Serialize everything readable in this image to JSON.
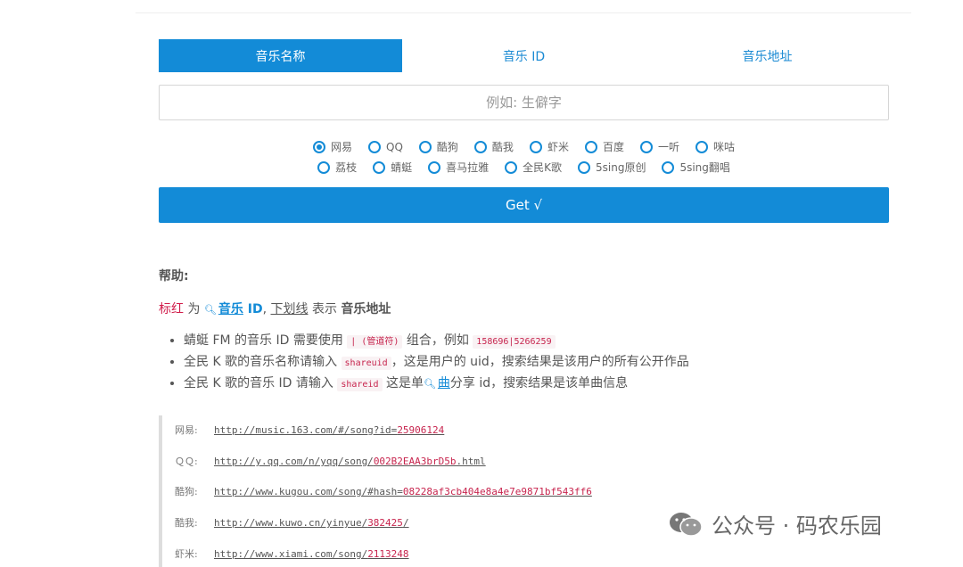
{
  "tabs": [
    {
      "label": "音乐名称",
      "active": true
    },
    {
      "label": "音乐 ID",
      "active": false
    },
    {
      "label": "音乐地址",
      "active": false
    }
  ],
  "search": {
    "placeholder": "例如: 生僻字",
    "value": ""
  },
  "sources": {
    "row1": [
      "网易",
      "QQ",
      "酷狗",
      "酷我",
      "虾米",
      "百度",
      "一听",
      "咪咕"
    ],
    "row2": [
      "荔枝",
      "蜻蜓",
      "喜马拉雅",
      "全民K歌",
      "5sing原创",
      "5sing翻唱"
    ],
    "selected": "网易"
  },
  "get_button": "Get √",
  "help": {
    "title": "帮助:",
    "legend": {
      "red": "标红",
      "wei": " 为 ",
      "music": "音乐",
      "id": " ID",
      "comma": ", ",
      "underline": "下划线",
      "means": " 表示 ",
      "address": "音乐地址"
    },
    "items": [
      {
        "t1": "蜻蜓 FM 的音乐 ID 需要使用 ",
        "c1": "| (管道符)",
        "t2": " 组合，例如 ",
        "c2": "158696|5266259"
      },
      {
        "t1": "全民 K 歌的音乐名称请输入 ",
        "c1": "shareuid",
        "t2": "，这是用户的 uid，搜索结果是该用户的所有公开作品"
      },
      {
        "t1": "全民 K 歌的音乐 ID 请输入 ",
        "c1": "shareid",
        "t2": " 这是单",
        "song": "曲",
        "t3": "分享 id，搜索结果是该单曲信息"
      }
    ]
  },
  "examples": [
    {
      "label": "网易:",
      "base": "http://music.163.com/#/song?id=",
      "id": "25906124"
    },
    {
      "label": "ＱＱ:",
      "base": "http://y.qq.com/n/yqq/song/",
      "id": "002B2EAA3brD5b",
      "suffix": ".html"
    },
    {
      "label": "酷狗:",
      "base": "http://www.kugou.com/song/#hash=",
      "id": "08228af3cb404e8a4e7e9871bf543ff6"
    },
    {
      "label": "酷我:",
      "base": "http://www.kuwo.cn/yinyue/",
      "id": "382425",
      "suffix": "/"
    },
    {
      "label": "虾米:",
      "base": "http://www.xiami.com/song/",
      "id": "2113248"
    }
  ],
  "watermark": {
    "text": "公众号 · 码农乐园"
  },
  "colors": {
    "accent": "#138bd7",
    "highlight": "#d11d4b"
  },
  "icons": [
    "search-icon",
    "wechat-icon"
  ]
}
